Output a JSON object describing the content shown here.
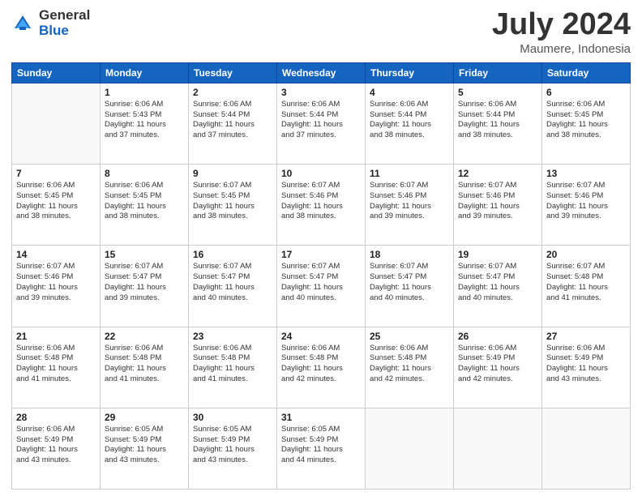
{
  "logo": {
    "general": "General",
    "blue": "Blue"
  },
  "title": "July 2024",
  "location": "Maumere, Indonesia",
  "days_of_week": [
    "Sunday",
    "Monday",
    "Tuesday",
    "Wednesday",
    "Thursday",
    "Friday",
    "Saturday"
  ],
  "weeks": [
    [
      {
        "day": "",
        "lines": []
      },
      {
        "day": "1",
        "lines": [
          "Sunrise: 6:06 AM",
          "Sunset: 5:43 PM",
          "Daylight: 11 hours",
          "and 37 minutes."
        ]
      },
      {
        "day": "2",
        "lines": [
          "Sunrise: 6:06 AM",
          "Sunset: 5:44 PM",
          "Daylight: 11 hours",
          "and 37 minutes."
        ]
      },
      {
        "day": "3",
        "lines": [
          "Sunrise: 6:06 AM",
          "Sunset: 5:44 PM",
          "Daylight: 11 hours",
          "and 37 minutes."
        ]
      },
      {
        "day": "4",
        "lines": [
          "Sunrise: 6:06 AM",
          "Sunset: 5:44 PM",
          "Daylight: 11 hours",
          "and 38 minutes."
        ]
      },
      {
        "day": "5",
        "lines": [
          "Sunrise: 6:06 AM",
          "Sunset: 5:44 PM",
          "Daylight: 11 hours",
          "and 38 minutes."
        ]
      },
      {
        "day": "6",
        "lines": [
          "Sunrise: 6:06 AM",
          "Sunset: 5:45 PM",
          "Daylight: 11 hours",
          "and 38 minutes."
        ]
      }
    ],
    [
      {
        "day": "7",
        "lines": [
          "Sunrise: 6:06 AM",
          "Sunset: 5:45 PM",
          "Daylight: 11 hours",
          "and 38 minutes."
        ]
      },
      {
        "day": "8",
        "lines": [
          "Sunrise: 6:06 AM",
          "Sunset: 5:45 PM",
          "Daylight: 11 hours",
          "and 38 minutes."
        ]
      },
      {
        "day": "9",
        "lines": [
          "Sunrise: 6:07 AM",
          "Sunset: 5:45 PM",
          "Daylight: 11 hours",
          "and 38 minutes."
        ]
      },
      {
        "day": "10",
        "lines": [
          "Sunrise: 6:07 AM",
          "Sunset: 5:46 PM",
          "Daylight: 11 hours",
          "and 38 minutes."
        ]
      },
      {
        "day": "11",
        "lines": [
          "Sunrise: 6:07 AM",
          "Sunset: 5:46 PM",
          "Daylight: 11 hours",
          "and 39 minutes."
        ]
      },
      {
        "day": "12",
        "lines": [
          "Sunrise: 6:07 AM",
          "Sunset: 5:46 PM",
          "Daylight: 11 hours",
          "and 39 minutes."
        ]
      },
      {
        "day": "13",
        "lines": [
          "Sunrise: 6:07 AM",
          "Sunset: 5:46 PM",
          "Daylight: 11 hours",
          "and 39 minutes."
        ]
      }
    ],
    [
      {
        "day": "14",
        "lines": [
          "Sunrise: 6:07 AM",
          "Sunset: 5:46 PM",
          "Daylight: 11 hours",
          "and 39 minutes."
        ]
      },
      {
        "day": "15",
        "lines": [
          "Sunrise: 6:07 AM",
          "Sunset: 5:47 PM",
          "Daylight: 11 hours",
          "and 39 minutes."
        ]
      },
      {
        "day": "16",
        "lines": [
          "Sunrise: 6:07 AM",
          "Sunset: 5:47 PM",
          "Daylight: 11 hours",
          "and 40 minutes."
        ]
      },
      {
        "day": "17",
        "lines": [
          "Sunrise: 6:07 AM",
          "Sunset: 5:47 PM",
          "Daylight: 11 hours",
          "and 40 minutes."
        ]
      },
      {
        "day": "18",
        "lines": [
          "Sunrise: 6:07 AM",
          "Sunset: 5:47 PM",
          "Daylight: 11 hours",
          "and 40 minutes."
        ]
      },
      {
        "day": "19",
        "lines": [
          "Sunrise: 6:07 AM",
          "Sunset: 5:47 PM",
          "Daylight: 11 hours",
          "and 40 minutes."
        ]
      },
      {
        "day": "20",
        "lines": [
          "Sunrise: 6:07 AM",
          "Sunset: 5:48 PM",
          "Daylight: 11 hours",
          "and 41 minutes."
        ]
      }
    ],
    [
      {
        "day": "21",
        "lines": [
          "Sunrise: 6:06 AM",
          "Sunset: 5:48 PM",
          "Daylight: 11 hours",
          "and 41 minutes."
        ]
      },
      {
        "day": "22",
        "lines": [
          "Sunrise: 6:06 AM",
          "Sunset: 5:48 PM",
          "Daylight: 11 hours",
          "and 41 minutes."
        ]
      },
      {
        "day": "23",
        "lines": [
          "Sunrise: 6:06 AM",
          "Sunset: 5:48 PM",
          "Daylight: 11 hours",
          "and 41 minutes."
        ]
      },
      {
        "day": "24",
        "lines": [
          "Sunrise: 6:06 AM",
          "Sunset: 5:48 PM",
          "Daylight: 11 hours",
          "and 42 minutes."
        ]
      },
      {
        "day": "25",
        "lines": [
          "Sunrise: 6:06 AM",
          "Sunset: 5:48 PM",
          "Daylight: 11 hours",
          "and 42 minutes."
        ]
      },
      {
        "day": "26",
        "lines": [
          "Sunrise: 6:06 AM",
          "Sunset: 5:49 PM",
          "Daylight: 11 hours",
          "and 42 minutes."
        ]
      },
      {
        "day": "27",
        "lines": [
          "Sunrise: 6:06 AM",
          "Sunset: 5:49 PM",
          "Daylight: 11 hours",
          "and 43 minutes."
        ]
      }
    ],
    [
      {
        "day": "28",
        "lines": [
          "Sunrise: 6:06 AM",
          "Sunset: 5:49 PM",
          "Daylight: 11 hours",
          "and 43 minutes."
        ]
      },
      {
        "day": "29",
        "lines": [
          "Sunrise: 6:05 AM",
          "Sunset: 5:49 PM",
          "Daylight: 11 hours",
          "and 43 minutes."
        ]
      },
      {
        "day": "30",
        "lines": [
          "Sunrise: 6:05 AM",
          "Sunset: 5:49 PM",
          "Daylight: 11 hours",
          "and 43 minutes."
        ]
      },
      {
        "day": "31",
        "lines": [
          "Sunrise: 6:05 AM",
          "Sunset: 5:49 PM",
          "Daylight: 11 hours",
          "and 44 minutes."
        ]
      },
      {
        "day": "",
        "lines": []
      },
      {
        "day": "",
        "lines": []
      },
      {
        "day": "",
        "lines": []
      }
    ]
  ]
}
